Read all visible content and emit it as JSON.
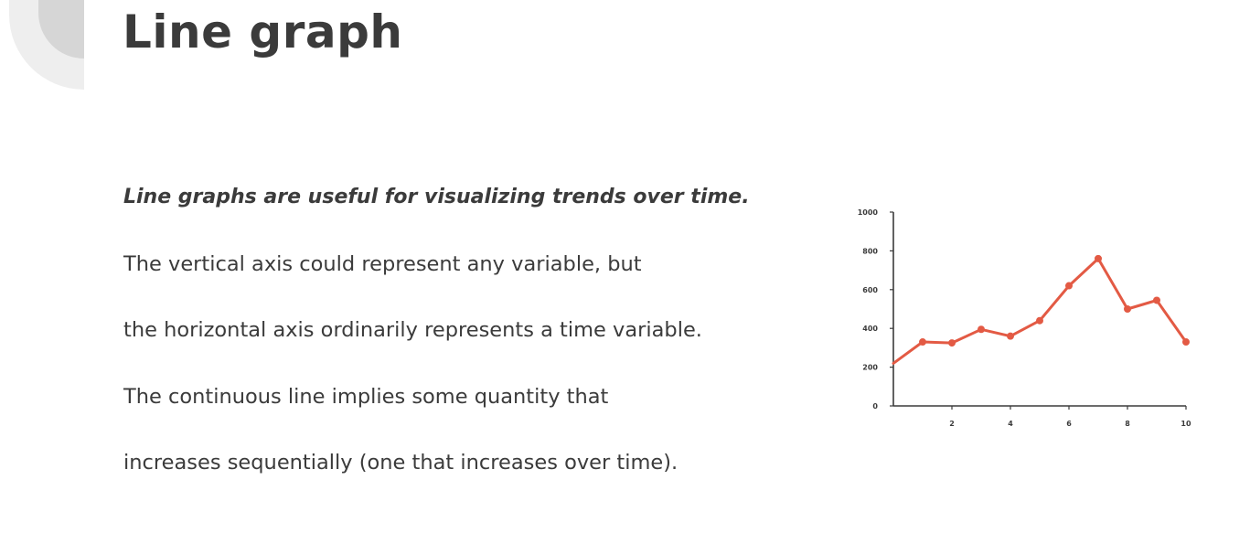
{
  "slide": {
    "title": "Line graph",
    "lead": "Line graphs are useful for visualizing trends over time.",
    "lines": [
      "The vertical axis could represent any variable, but",
      "the horizontal axis ordinarily represents a time variable.",
      "The continuous line implies some quantity that",
      "increases sequentially (one that increases over time)."
    ]
  },
  "colors": {
    "line": "#e35a44",
    "axis": "#3b3b3b",
    "deco_outer": "#eeeeee",
    "deco_inner": "#d6d6d6"
  },
  "chart_data": {
    "type": "line",
    "title": "",
    "xlabel": "",
    "ylabel": "",
    "x": [
      0,
      1,
      2,
      3,
      4,
      5,
      6,
      7,
      8,
      9,
      10
    ],
    "values": [
      220,
      330,
      325,
      395,
      360,
      440,
      620,
      760,
      500,
      545,
      330
    ],
    "xlim": [
      0,
      10
    ],
    "ylim": [
      0,
      1000
    ],
    "xticks": [
      2,
      4,
      6,
      8,
      10
    ],
    "yticks": [
      0,
      200,
      400,
      600,
      800,
      1000
    ],
    "grid": false,
    "legend": "none"
  }
}
